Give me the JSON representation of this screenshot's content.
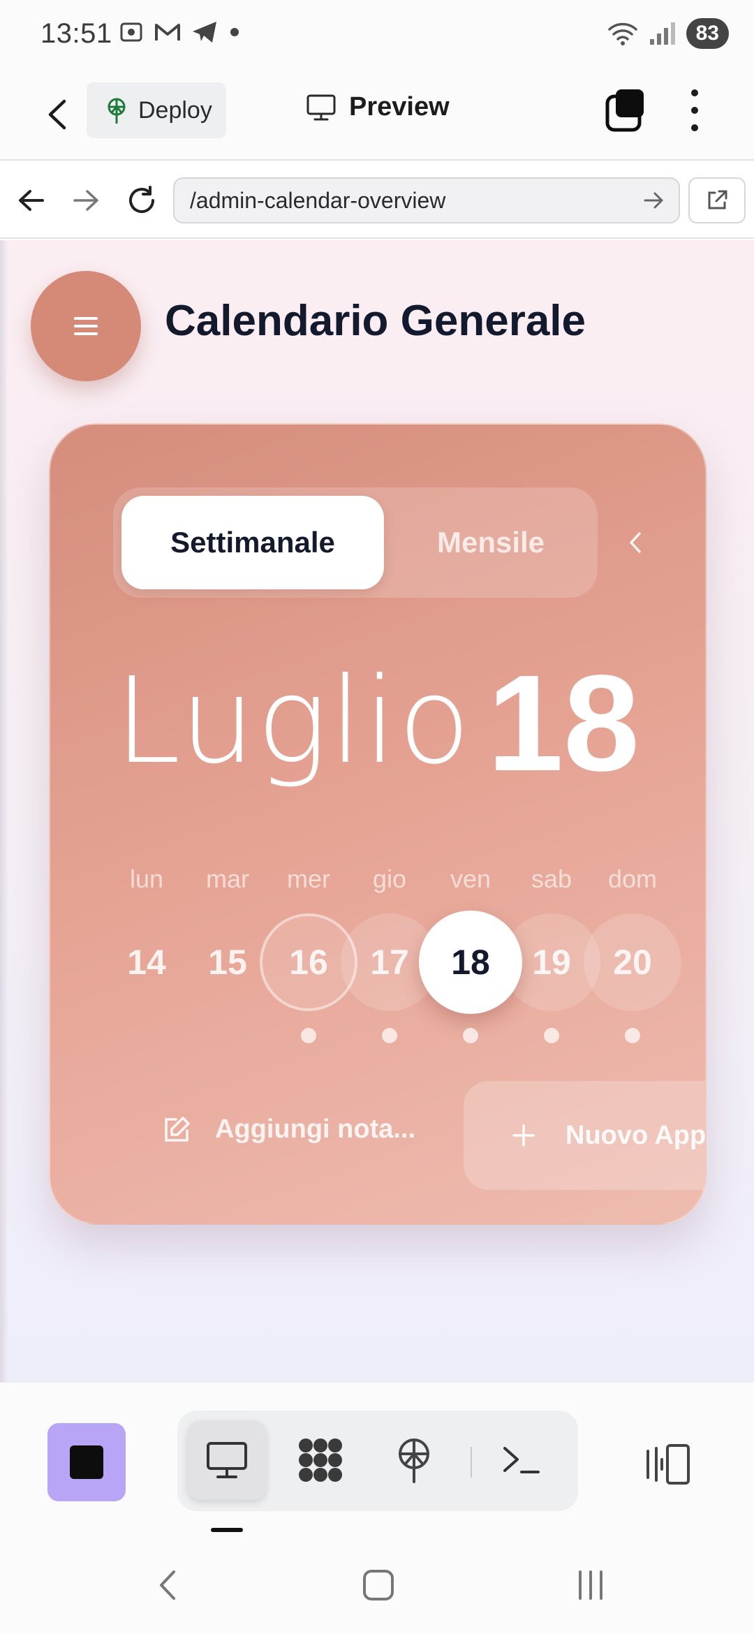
{
  "status_bar": {
    "time": "13:51",
    "battery": "83",
    "left_icons": [
      "screenshot-icon",
      "gmail-icon",
      "telegram-icon",
      "dot-icon"
    ],
    "right_icons": [
      "wifi-icon",
      "signal-icon"
    ]
  },
  "app_bar": {
    "deploy_label": "Deploy",
    "preview_label": "Preview"
  },
  "url_bar": {
    "url": "/admin-calendar-overview"
  },
  "page": {
    "title": "Calendario Generale",
    "view_toggle": {
      "weekly": "Settimanale",
      "monthly": "Mensile",
      "selected": "Settimanale"
    },
    "month": "Luglio",
    "selected_day": "18",
    "weekdays": [
      "lun",
      "mar",
      "mer",
      "gio",
      "ven",
      "sab",
      "dom"
    ],
    "dates": [
      "14",
      "15",
      "16",
      "17",
      "18",
      "19",
      "20"
    ],
    "add_note_label": "Aggiungi nota...",
    "new_appointment_label": "Nuovo App"
  },
  "colors": {
    "accent": "#d58a78",
    "card_top": "#d58d7c",
    "card_bottom": "#eebcb0",
    "stop_button": "#b8a5f6",
    "title_text": "#141a2e"
  }
}
